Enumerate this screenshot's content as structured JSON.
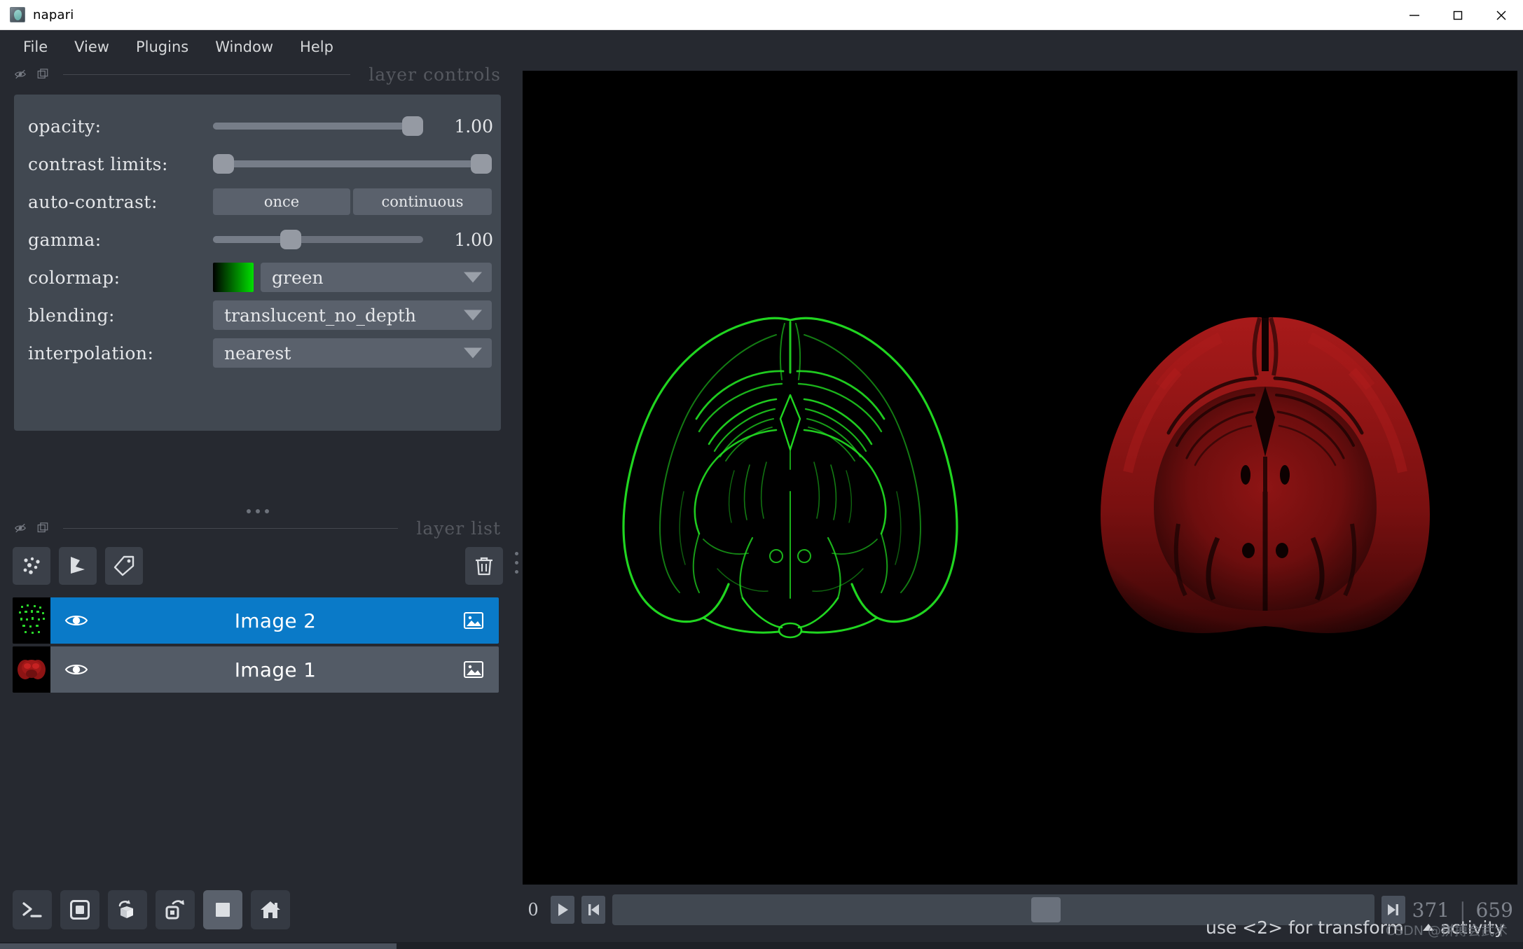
{
  "window": {
    "title": "napari",
    "icon": "napari-logo-icon",
    "buttons": [
      {
        "name": "minimize-button",
        "glyph": "minimize-icon"
      },
      {
        "name": "maximize-button",
        "glyph": "maximize-icon"
      },
      {
        "name": "close-button",
        "glyph": "close-icon"
      }
    ]
  },
  "menubar": {
    "items": [
      {
        "label": "File"
      },
      {
        "label": "View"
      },
      {
        "label": "Plugins"
      },
      {
        "label": "Window"
      },
      {
        "label": "Help"
      }
    ]
  },
  "layer_controls": {
    "section_title": "layer controls",
    "rows": {
      "opacity": {
        "label": "opacity:",
        "value": "1.00",
        "slider_percent": 100
      },
      "contrast_limits": {
        "label": "contrast limits:",
        "low_percent": 0,
        "high_percent": 100
      },
      "auto_contrast": {
        "label": "auto-contrast:",
        "once_label": "once",
        "continuous_label": "continuous"
      },
      "gamma": {
        "label": "gamma:",
        "value": "1.00",
        "slider_percent": 37
      },
      "colormap": {
        "label": "colormap:",
        "value": "green",
        "swatch_from": "#000000",
        "swatch_to": "#00e000"
      },
      "blending": {
        "label": "blending:",
        "value": "translucent_no_depth"
      },
      "interpolation": {
        "label": "interpolation:",
        "value": "nearest"
      }
    }
  },
  "layer_list": {
    "section_title": "layer list",
    "tools": [
      {
        "name": "new-points-layer-button",
        "icon": "points-icon"
      },
      {
        "name": "new-shapes-layer-button",
        "icon": "shapes-icon"
      },
      {
        "name": "new-labels-layer-button",
        "icon": "labels-tag-icon"
      },
      {
        "name": "delete-layer-button",
        "icon": "trash-icon"
      }
    ],
    "layers": [
      {
        "name": "Image 2",
        "selected": true,
        "visible": true,
        "type_icon": "image-layer-icon",
        "thumbnail_color": "#22cc22"
      },
      {
        "name": "Image 1",
        "selected": false,
        "visible": true,
        "type_icon": "image-layer-icon",
        "thumbnail_color": "#c01c1c"
      }
    ],
    "selected_color": "#0a7ac8"
  },
  "viewer_buttons": [
    {
      "name": "console-button",
      "icon": "console-prompt-icon",
      "active": false
    },
    {
      "name": "toggle-ndisplay-2d-button",
      "icon": "square-2d-icon",
      "active": false
    },
    {
      "name": "roll-dimensions-button",
      "icon": "cube-roll-icon",
      "active": false
    },
    {
      "name": "transpose-dimensions-button",
      "icon": "square-transpose-icon",
      "active": false
    },
    {
      "name": "grid-view-button",
      "icon": "grid-square-icon",
      "active": true
    },
    {
      "name": "reset-view-home-button",
      "icon": "home-icon",
      "active": false
    }
  ],
  "canvas": {
    "background": "#000000",
    "layers_rendered": [
      {
        "name": "Image 2",
        "colormap": "green",
        "description": "coronal mouse brain slice edge map"
      },
      {
        "name": "Image 1",
        "colormap": "red",
        "description": "coronal mouse brain slice intensity"
      }
    ]
  },
  "dims": {
    "axis_label": "0",
    "play_button": "play-icon",
    "step_to_first_button": "skip-to-start-icon",
    "step_to_last_button": "skip-to-end-icon",
    "current_value": "371",
    "separator": "|",
    "max_value": "659",
    "handle_percent": 55
  },
  "statusbar": {
    "hint": "use <2> for transform",
    "activity_label": "activity",
    "activity_icon": "chevron-up-icon",
    "watermark": "CSDN @拼搏会武术"
  }
}
